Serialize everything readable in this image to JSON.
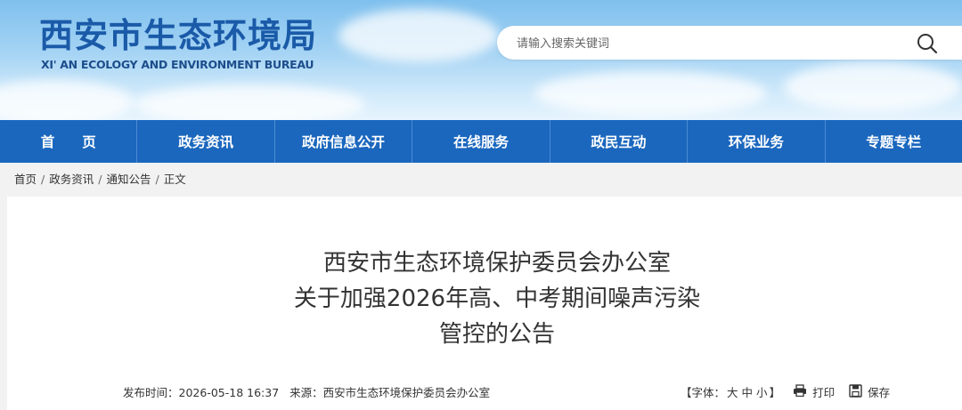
{
  "header": {
    "logo_cn": "西安市生态环境局",
    "logo_en": "XI' AN ECOLOGY AND ENVIRONMENT BUREAU",
    "search_placeholder": "请输入搜索关键词"
  },
  "nav": {
    "items": [
      "首　　页",
      "政务资讯",
      "政府信息公开",
      "在线服务",
      "政民互动",
      "环保业务",
      "专题专栏"
    ]
  },
  "breadcrumb": {
    "items": [
      "首页",
      "政务资讯",
      "通知公告",
      "正文"
    ],
    "separator": "/"
  },
  "article": {
    "title_lines": [
      "西安市生态环境保护委员会办公室",
      "关于加强2026年高、中考期间噪声污染",
      "管控的公告"
    ],
    "publish_label": "发布时间：",
    "publish_time": "2026-05-18 16:37",
    "source_label": "来源：",
    "source": "西安市生态环境保护委员会办公室"
  },
  "tools": {
    "font_label": "【字体：",
    "font_large": "大",
    "font_medium": "中",
    "font_small": "小",
    "font_end": "】",
    "print": "打印",
    "save": "保存"
  },
  "colors": {
    "nav_bg": "#1b67be",
    "logo": "#1a5aa8"
  }
}
